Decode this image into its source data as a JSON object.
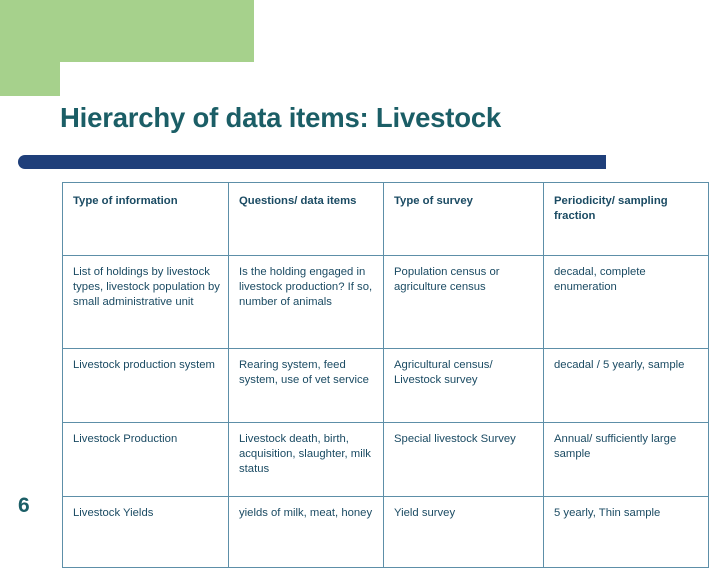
{
  "slide": {
    "title": "Hierarchy of data items: Livestock",
    "number": "6",
    "accent_green": "#a6d18c",
    "accent_blue": "#1f3f7a",
    "title_color": "#1b5e66"
  },
  "table": {
    "headers": [
      "Type of information",
      "Questions/ data items",
      "Type of survey",
      "Periodicity/ sampling fraction"
    ],
    "rows": [
      {
        "type_of_information": "List of holdings by livestock types, livestock population by small administrative unit",
        "questions": "Is the holding engaged in livestock production? If so, number of animals",
        "survey": "Population census or agriculture census",
        "periodicity": "decadal, complete enumeration"
      },
      {
        "type_of_information": "Livestock production system",
        "questions": "Rearing system, feed system, use of vet service",
        "survey": "Agricultural census/ Livestock survey",
        "periodicity": "decadal / 5 yearly, sample"
      },
      {
        "type_of_information": "Livestock Production",
        "questions": "Livestock death, birth, acquisition, slaughter, milk status",
        "survey": "Special livestock Survey",
        "periodicity": "Annual/ sufficiently large sample"
      },
      {
        "type_of_information": "Livestock Yields",
        "questions": "yields of milk, meat, honey",
        "survey": "Yield survey",
        "periodicity": "5 yearly, Thin sample"
      }
    ]
  }
}
